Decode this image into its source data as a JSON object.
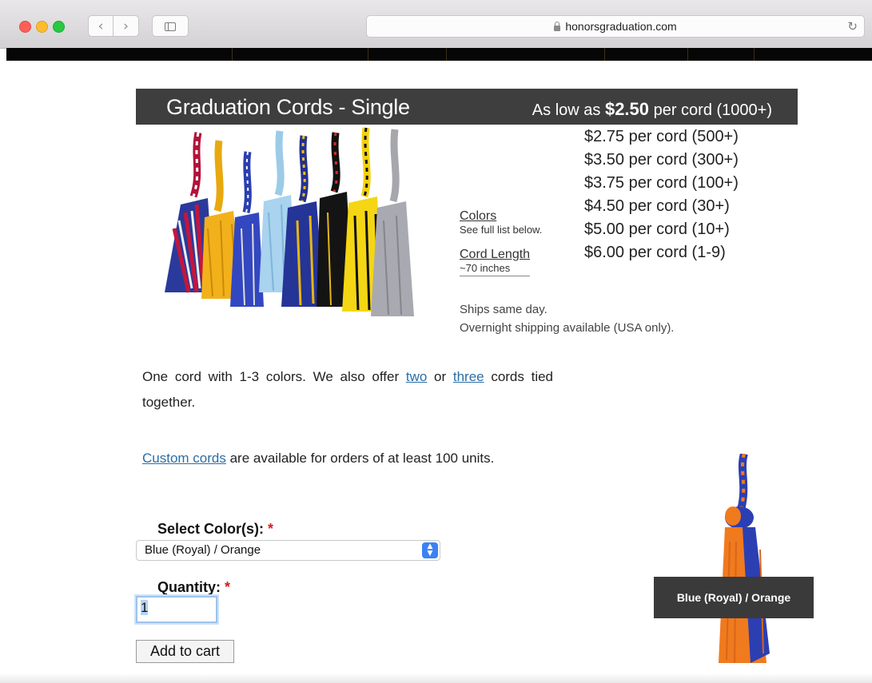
{
  "browser": {
    "url": "honorsgraduation.com",
    "back_icon": "‹",
    "forward_icon": "›",
    "reload_icon": "↻"
  },
  "banner": {
    "title": "Graduation Cords - Single",
    "price_prefix": "As low as ",
    "price_value": "$2.50",
    "price_suffix": " per cord (1000+)"
  },
  "tiers": [
    "$2.75 per cord (500+)",
    "$3.50 per cord (300+)",
    "$3.75 per cord (100+)",
    "$4.50 per cord (30+)",
    "$5.00 per cord (10+)",
    "$6.00 per cord (1-9)"
  ],
  "specs": {
    "colors_label": "Colors",
    "colors_note": "See full list below.",
    "length_label": "Cord Length",
    "length_value": "~70 inches"
  },
  "shipping": {
    "line1": "Ships same day.",
    "line2": "Overnight shipping available (USA only)."
  },
  "description": {
    "p1_pre": "One cord with 1-3 colors. We also offer ",
    "p1_link1": "two",
    "p1_mid": " or ",
    "p1_link2": "three",
    "p1_post": " cords tied together.",
    "p2_link": "Custom cords",
    "p2_post": " are available for orders of at least 100 units."
  },
  "form": {
    "color_label": "Select Color(s):",
    "required_mark": "*",
    "color_value": "Blue (Royal) / Orange",
    "quantity_label": "Quantity:",
    "quantity_value": "1",
    "add_to_cart": "Add to cart"
  },
  "preview": {
    "caption": "Blue (Royal) / Orange"
  },
  "colors": {
    "royal_blue": "#2b3fb3",
    "orange": "#f07a1e",
    "banner_bg": "#3e3e3e",
    "link": "#2a6ea6"
  }
}
